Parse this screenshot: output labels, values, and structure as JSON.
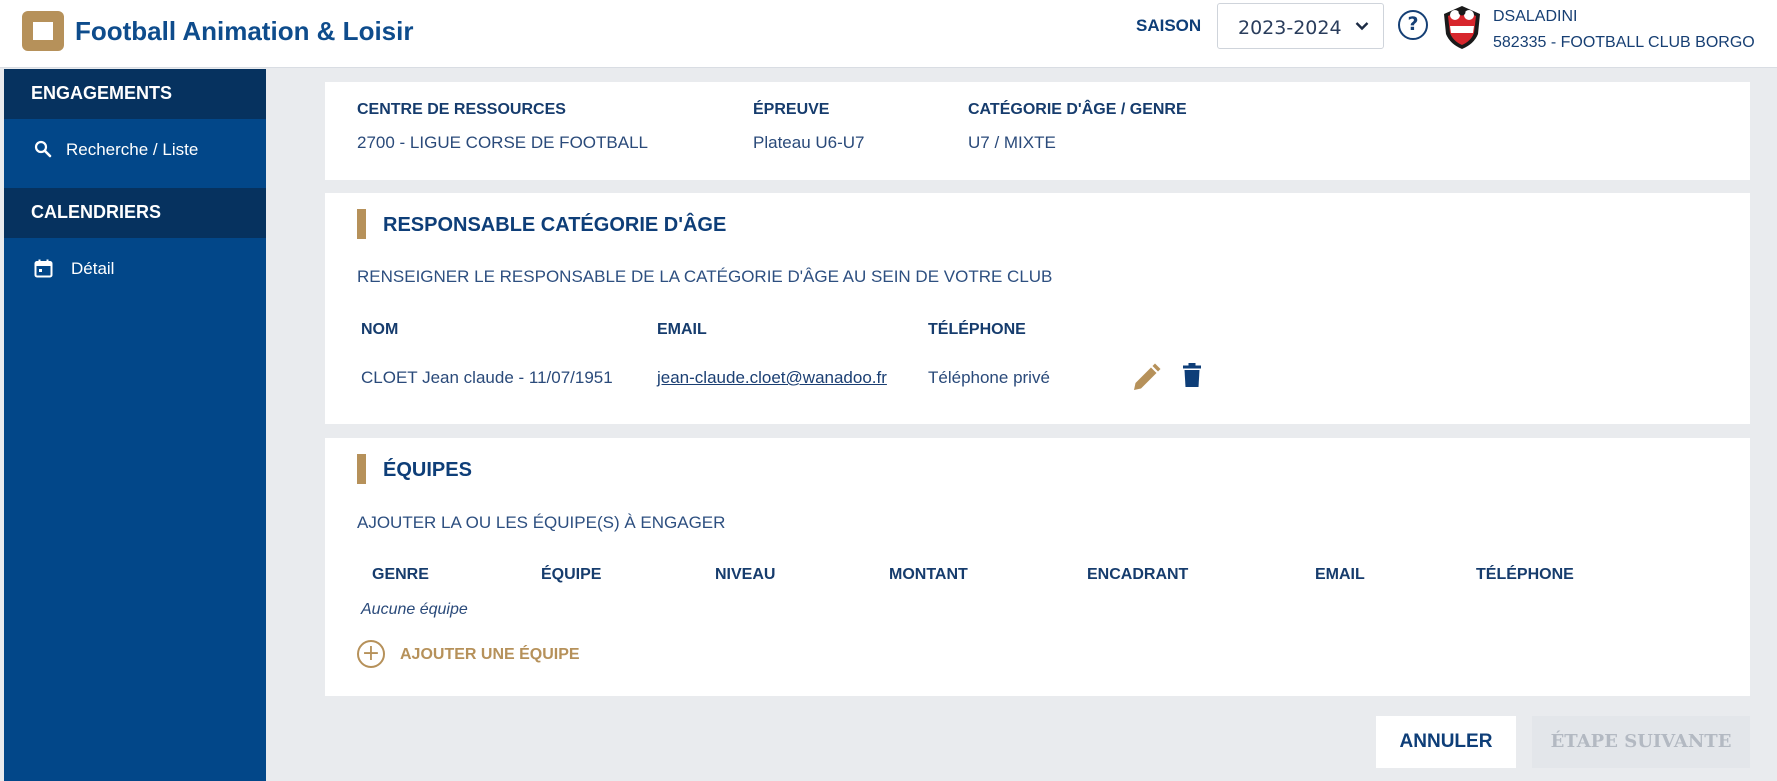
{
  "header": {
    "app_title": "Football Animation & Loisir",
    "season_label": "SAISON",
    "season_value": "2023-2024",
    "help_symbol": "?",
    "user_name": "DSALADINI",
    "user_club": "582335 - FOOTBALL CLUB BORGO"
  },
  "sidebar": {
    "section1": "ENGAGEMENTS",
    "item1": "Recherche / Liste",
    "section2": "CALENDRIERS",
    "item2": "Détail"
  },
  "info": {
    "centre_label": "CENTRE DE RESSOURCES",
    "centre_value": "2700 - LIGUE CORSE DE FOOTBALL",
    "epreuve_label": "ÉPREUVE",
    "epreuve_value": "Plateau U6-U7",
    "categorie_label": "CATÉGORIE D'ÂGE / GENRE",
    "categorie_value": "U7 / MIXTE"
  },
  "responsable": {
    "title": "RESPONSABLE CATÉGORIE D'ÂGE",
    "subtitle": "RENSEIGNER LE RESPONSABLE DE LA CATÉGORIE D'ÂGE AU SEIN DE VOTRE CLUB",
    "col_nom": "NOM",
    "col_email": "EMAIL",
    "col_tel": "TÉLÉPHONE",
    "row": {
      "nom": "CLOET Jean claude - 11/07/1951",
      "email": "jean-claude.cloet@wanadoo.fr",
      "tel": "Téléphone privé"
    }
  },
  "equipes": {
    "title": "ÉQUIPES",
    "subtitle": "AJOUTER LA OU LES ÉQUIPE(S) À ENGAGER",
    "columns": [
      "GENRE",
      "ÉQUIPE",
      "NIVEAU",
      "MONTANT",
      "ENCADRANT",
      "EMAIL",
      "TÉLÉPHONE"
    ],
    "empty": "Aucune équipe",
    "add_plus": "+",
    "add_label": "AJOUTER UNE ÉQUIPE"
  },
  "footer": {
    "cancel": "ANNULER",
    "next": "ÉTAPE SUIVANTE"
  },
  "colors": {
    "sidebar": "#024789",
    "sidebar_header": "#06325f",
    "gold": "#b6915a",
    "navy": "#0e3e78"
  }
}
